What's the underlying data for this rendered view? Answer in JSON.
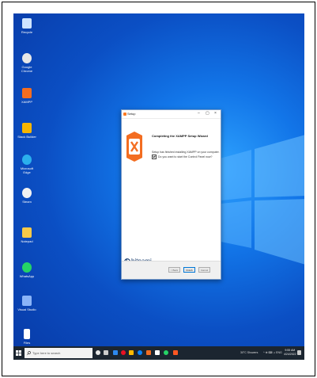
{
  "desktop": {
    "icons": [
      {
        "label": "Recycle",
        "color": "#cfe4ff"
      },
      {
        "label": "Google Chrome",
        "color": "#e7e7e7"
      },
      {
        "label": "XAMPP",
        "color": "#f36d21"
      },
      {
        "label": "Stack Builder",
        "color": "#f7b500"
      },
      {
        "label": "Microsoft Edge",
        "color": "#2bb0ed"
      },
      {
        "label": "Steam",
        "color": "#f2f2f2"
      },
      {
        "label": "Notepad",
        "color": "#f7c948"
      },
      {
        "label": "WhatsApp",
        "color": "#25d366"
      },
      {
        "label": "Visual Studio",
        "color": "#8ab4f8"
      },
      {
        "label": "Files",
        "color": "#ffffff"
      }
    ]
  },
  "dialog": {
    "title": "Setup",
    "heading": "Completing the XAMPP Setup Wizard",
    "description": "Setup has finished installing XAMPP on your computer.",
    "checkbox_label": "Do you want to start the Control Panel now?",
    "checkbox_checked": true,
    "brand": "bitnami",
    "buttons": {
      "back": "< Back",
      "finish": "Finish",
      "cancel": "Cancel"
    },
    "minimize": "–",
    "maximize": "▢",
    "close": "×"
  },
  "taskbar": {
    "search_placeholder": "Type here to search",
    "weather": "30°C Showers",
    "tray": "^ ⊕ ⌨ ♫ ENG",
    "time": "9:55 AM",
    "date": "4/24/2022",
    "pinned_colors": [
      "#e6e6e6",
      "#cccccc",
      "#2d89ef",
      "#e81123",
      "#ffb900",
      "#0a84ff",
      "#f36d21",
      "#ffffff",
      "#25d366",
      "#ff5722"
    ]
  }
}
